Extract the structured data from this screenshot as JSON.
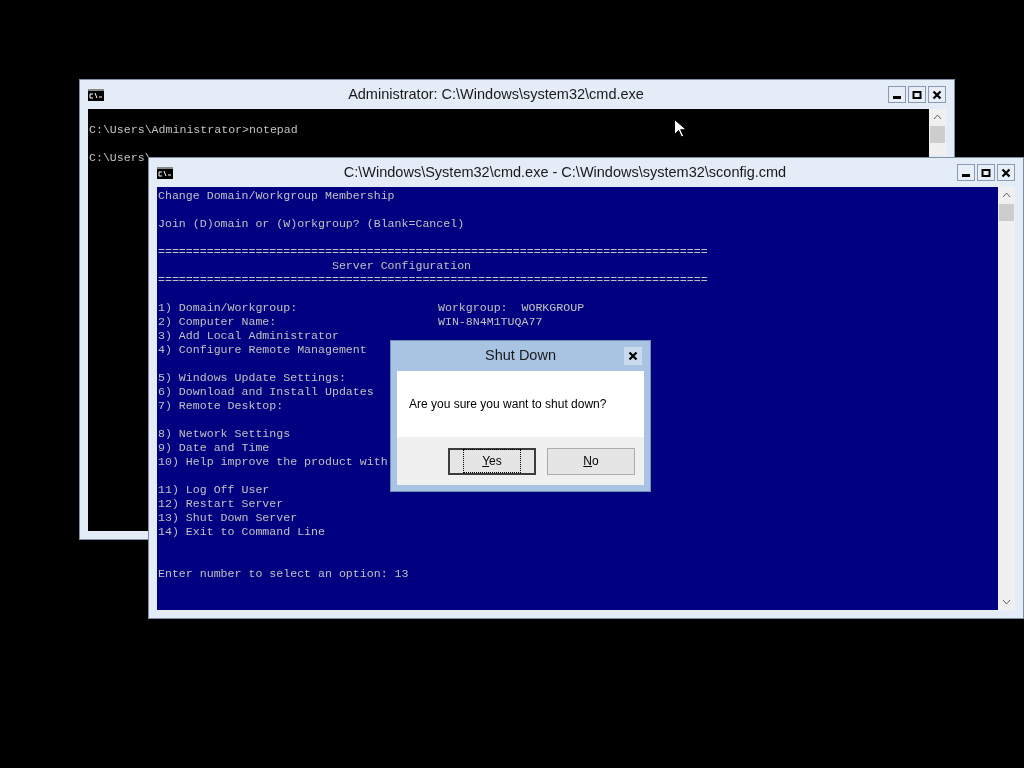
{
  "back_window": {
    "title": "Administrator: C:\\Windows\\system32\\cmd.exe",
    "lines": [
      {
        "kind": "line",
        "text": "C:\\Users\\Administrator>notepad"
      },
      {
        "kind": "blank"
      },
      {
        "kind": "line",
        "text": "C:\\Users\\"
      }
    ]
  },
  "front_window": {
    "title": "C:\\Windows\\System32\\cmd.exe - C:\\Windows\\system32\\sconfig.cmd",
    "lines": [
      {
        "kind": "line",
        "text": "Change Domain/Workgroup Membership"
      },
      {
        "kind": "blank"
      },
      {
        "kind": "line",
        "text": "Join (D)omain or (W)orkgroup? (Blank=Cancel)"
      },
      {
        "kind": "blank"
      },
      {
        "kind": "line",
        "text": "==============================================================================="
      },
      {
        "kind": "line",
        "text": "                         Server Configuration"
      },
      {
        "kind": "line",
        "text": "==============================================================================="
      },
      {
        "kind": "blank"
      },
      {
        "kind": "line",
        "text": "1) Domain/Workgroup:",
        "value": "Workgroup:  WORKGROUP"
      },
      {
        "kind": "line",
        "text": "2) Computer Name:",
        "value": "WIN-8N4M1TUQA77"
      },
      {
        "kind": "line",
        "text": "3) Add Local Administrator"
      },
      {
        "kind": "line",
        "text": "4) Configure Remote Management"
      },
      {
        "kind": "blank"
      },
      {
        "kind": "line",
        "text": "5) Windows Update Settings:"
      },
      {
        "kind": "line",
        "text": "6) Download and Install Updates"
      },
      {
        "kind": "line",
        "text": "7) Remote Desktop:"
      },
      {
        "kind": "blank"
      },
      {
        "kind": "line",
        "text": "8) Network Settings"
      },
      {
        "kind": "line",
        "text": "9) Date and Time"
      },
      {
        "kind": "line",
        "text": "10) Help improve the product with"
      },
      {
        "kind": "blank"
      },
      {
        "kind": "line",
        "text": "11) Log Off User"
      },
      {
        "kind": "line",
        "text": "12) Restart Server"
      },
      {
        "kind": "line",
        "text": "13) Shut Down Server"
      },
      {
        "kind": "line",
        "text": "14) Exit to Command Line"
      },
      {
        "kind": "blank"
      },
      {
        "kind": "blank"
      },
      {
        "kind": "line",
        "text": "Enter number to select an option: 13"
      }
    ]
  },
  "dialog": {
    "title": "Shut Down",
    "message": "Are you sure you want to shut down?",
    "buttons": [
      {
        "label": "Yes",
        "focused": true
      },
      {
        "label": "No",
        "focused": false
      }
    ]
  }
}
